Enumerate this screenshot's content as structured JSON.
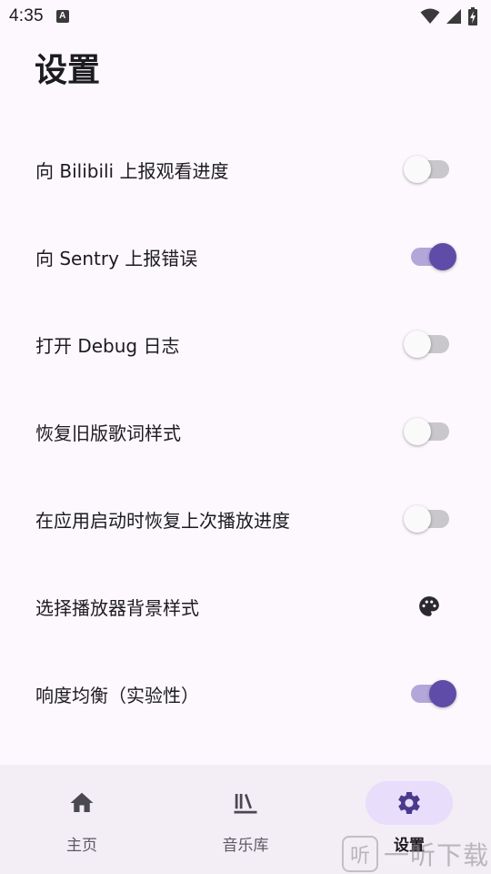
{
  "status_bar": {
    "time": "4:35",
    "notification_icon_letter": "A"
  },
  "page": {
    "title": "设置"
  },
  "settings": [
    {
      "label": "向 Bilibili 上报观看进度",
      "control": "switch",
      "on": false
    },
    {
      "label": "向 Sentry 上报错误",
      "control": "switch",
      "on": true
    },
    {
      "label": "打开 Debug 日志",
      "control": "switch",
      "on": false
    },
    {
      "label": "恢复旧版歌词样式",
      "control": "switch",
      "on": false
    },
    {
      "label": "在应用启动时恢复上次播放进度",
      "control": "switch",
      "on": false
    },
    {
      "label": "选择播放器背景样式",
      "control": "palette-icon"
    },
    {
      "label": "响度均衡（实验性）",
      "control": "switch",
      "on": true
    }
  ],
  "bottom_nav": {
    "items": [
      {
        "label": "主页",
        "icon": "home-icon",
        "active": false
      },
      {
        "label": "音乐库",
        "icon": "library-icon",
        "active": false
      },
      {
        "label": "设置",
        "icon": "gear-icon",
        "active": true
      }
    ]
  },
  "watermark": {
    "logo_glyph": "听",
    "text": "一听下载"
  },
  "colors": {
    "background": "#fdf8fd",
    "accent": "#5e4ca8",
    "accent_track": "#b3a6d9",
    "nav_background": "#f3edf6",
    "nav_active_pill": "#e8ddfb"
  }
}
